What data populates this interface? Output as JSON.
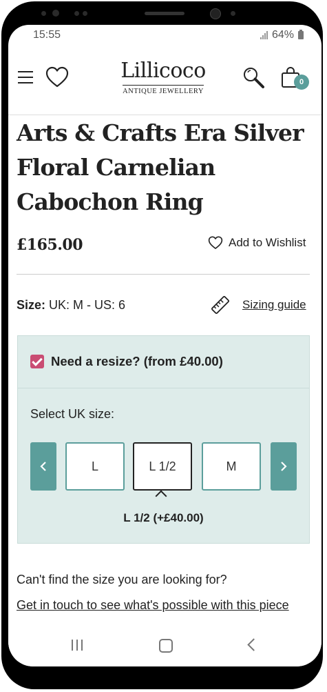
{
  "status_bar": {
    "time": "15:55",
    "battery": "64%"
  },
  "header": {
    "logo_name": "Lillicoco",
    "logo_tagline": "ANTIQUE JEWELLERY",
    "cart_count": "0"
  },
  "product": {
    "title": "Arts & Crafts Era Silver Floral Carnelian Cabochon Ring",
    "price": "£165.00",
    "wishlist_label": "Add to Wishlist"
  },
  "size": {
    "label": "Size:",
    "value": "UK: M - US: 6",
    "guide_label": "Sizing guide"
  },
  "resize": {
    "checked": true,
    "label": "Need a resize? (from £40.00)",
    "select_label": "Select UK size:",
    "options": [
      "L",
      "L 1/2",
      "M"
    ],
    "selected": "L 1/2",
    "selected_price": "L 1/2 (+£40.00)"
  },
  "help": {
    "question": "Can't find the size you are looking for?",
    "link": "Get in touch to see what's possible with this piece"
  },
  "colors": {
    "accent": "#5b9e9b",
    "checkbox": "#c94d73",
    "panel": "#deecea"
  }
}
